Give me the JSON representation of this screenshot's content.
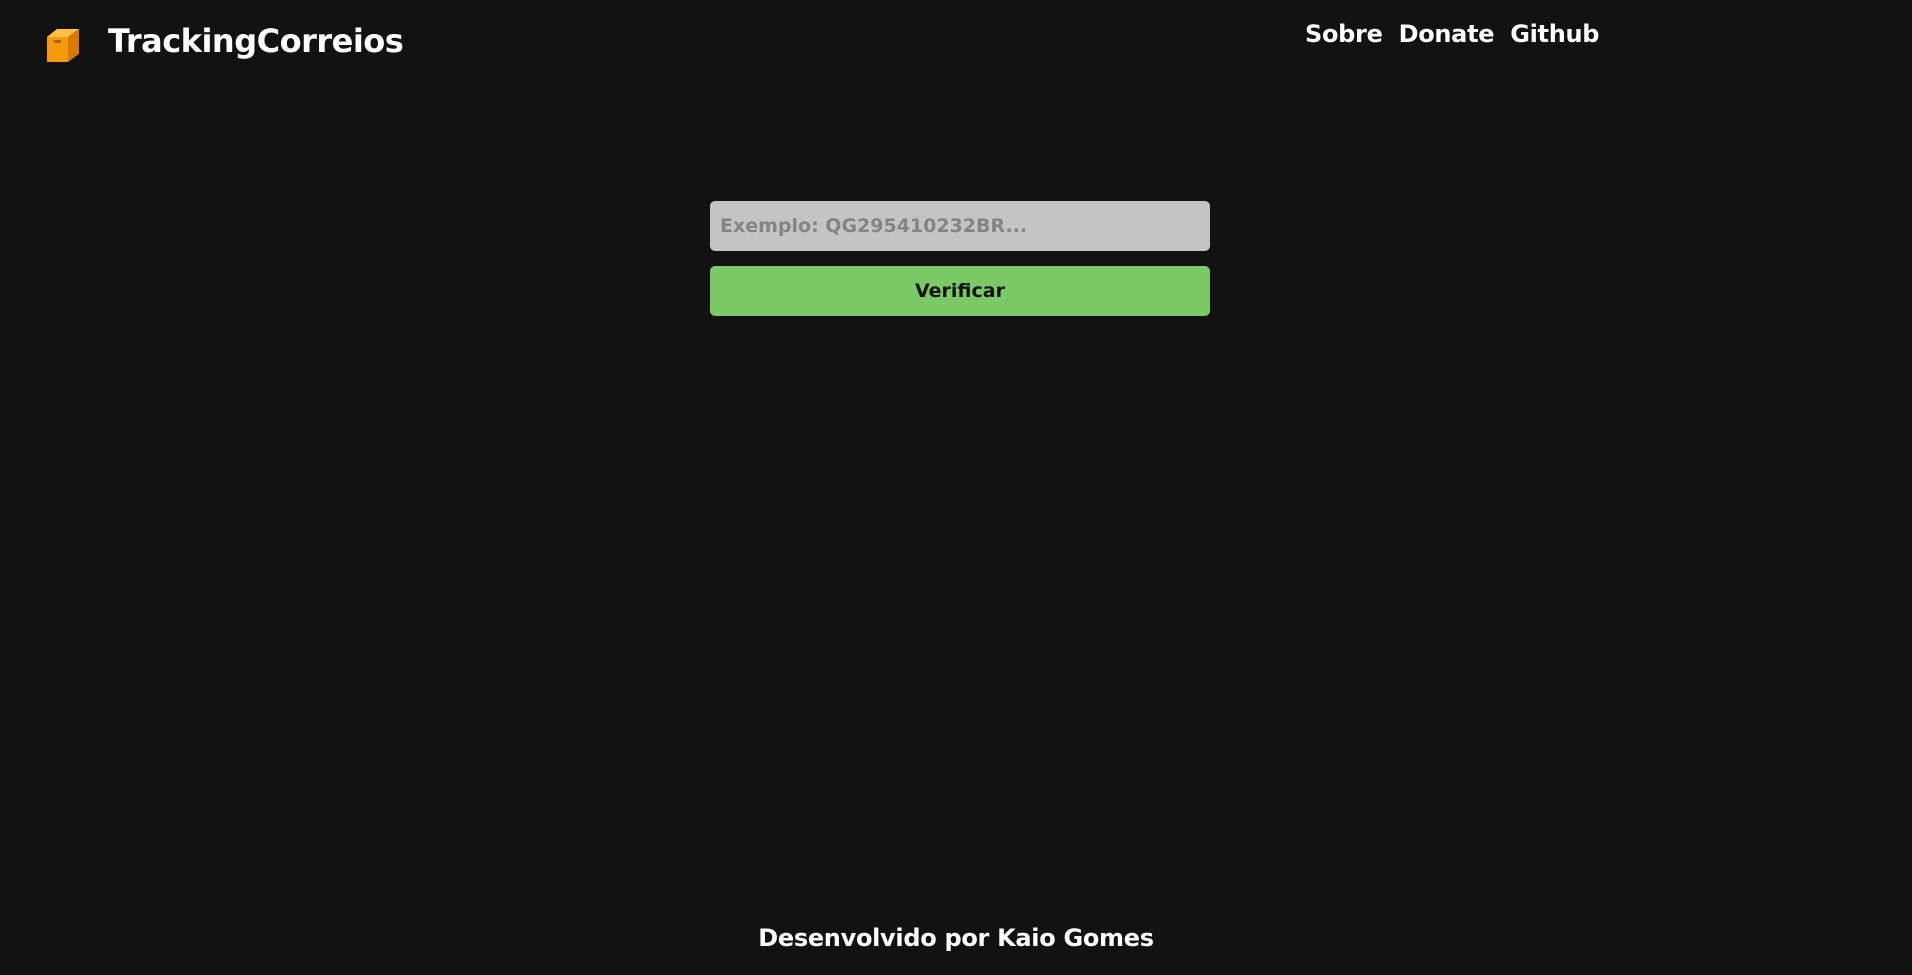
{
  "header": {
    "brand": "TrackingCorreios",
    "logo_icon": "package-box-icon",
    "nav": [
      {
        "label": "Sobre"
      },
      {
        "label": "Donate"
      },
      {
        "label": "Github"
      }
    ]
  },
  "search": {
    "placeholder": "Exemplo: QG295410232BR...",
    "value": "",
    "button_label": "Verificar"
  },
  "footer": {
    "text": "Desenvolvido por Kaio Gomes"
  },
  "colors": {
    "background": "#121212",
    "input_background": "#c4c4c4",
    "button_accent": "#7bc966",
    "logo_orange": "#f5a623"
  }
}
